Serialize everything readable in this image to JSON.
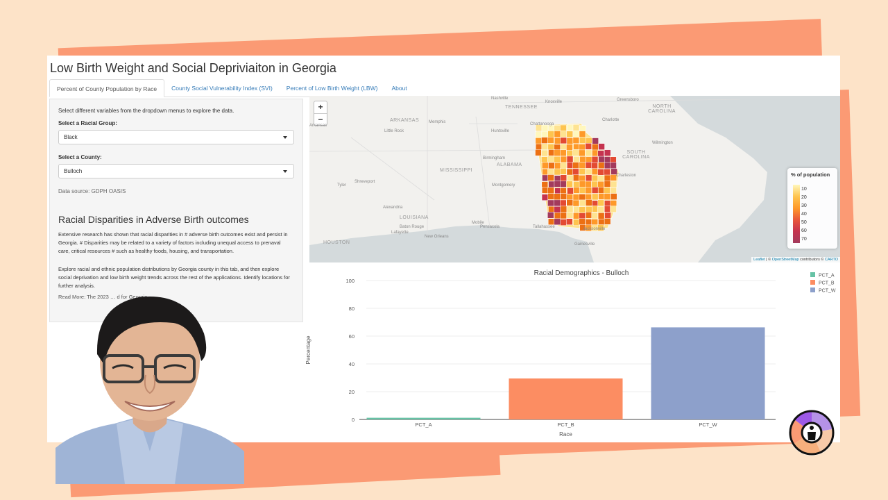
{
  "app": {
    "title": "Low Birth Weight and Social Depriviaiton in Georgia",
    "tabs": [
      {
        "label": "Percent of County Population by Race",
        "active": true
      },
      {
        "label": "County Social Vulnerability Index (SVI)",
        "active": false
      },
      {
        "label": "Percent of Low Birth Weight (LBW)",
        "active": false
      },
      {
        "label": "About",
        "active": false
      }
    ]
  },
  "sidebar": {
    "help_text": "Select different variables from the dropdown menus to explore the data.",
    "race_label": "Select a Racial Group:",
    "race_value": "Black",
    "county_label": "Select a County:",
    "county_value": "Bulloch",
    "data_source": "Data source: GDPH OASIS",
    "heading": "Racial Disparities in Adverse Birth outcomes",
    "paragraph1": "Extensive research has shown that racial disparities in # adverse birth outcomes exist and persist in Georgia. # Disparities may be related to a variety of factors including unequal access to prenaval care, critical resources # such as healthy foods, housing, and transportation.",
    "paragraph2": "Explore racial and ethnic population distributions by Georgia county in this tab, and then explore social deprivation and low birth weight trends across the rest of the applications. Identify locations for further analysis.",
    "read_more": "Read More: The 2023 … d for Georgia"
  },
  "map": {
    "zoom_in": "+",
    "zoom_out": "−",
    "labels": {
      "nashville": "Nashville",
      "knoxville": "Knoxville",
      "greensboro": "Greensboro",
      "tennessee": "TENNESSEE",
      "north_carolina": "NORTH CAROLINA",
      "arkansas": "ARKANSAS",
      "memphis": "Memphis",
      "chattanooga": "Chattanooga",
      "charlotte": "Charlotte",
      "little_rock": "Little Rock",
      "huntsville": "Huntsville",
      "wilmington": "Wilmington",
      "mississippi": "MISSISSIPPI",
      "birmingham": "Birmingham",
      "alabama": "ALABAMA",
      "south_carolina": "SOUTH CAROLINA",
      "tyler": "Tyler",
      "shreveport": "Shreveport",
      "montgomery": "Montgomery",
      "charleston": "Charleston",
      "alexandria": "Alexandria",
      "louisiana": "LOUISIANA",
      "baton_rouge": "Baton Rouge",
      "lafayette": "Lafayette",
      "new_orleans": "New Orleans",
      "mobile": "Mobile",
      "pensacola": "Pensacola",
      "tallahassee": "Tallahassee",
      "jacksonville": "Jacksonville",
      "houston": "HOUSTON",
      "gainesville": "Gainesville",
      "arkansas_small": "Arkansas"
    },
    "legend": {
      "title": "% of population",
      "ticks": [
        "10",
        "20",
        "30",
        "40",
        "50",
        "60",
        "70"
      ]
    },
    "attribution": {
      "leaflet": "Leaflet",
      "sep": " | © ",
      "osm": "OpenStreetMap",
      "contrib": " contributors © ",
      "carto": "CARTO"
    },
    "colors": [
      "#fff7bc",
      "#fee391",
      "#fec44f",
      "#fe9929",
      "#ec7014",
      "#e34a33",
      "#c5334f",
      "#a33a5c"
    ]
  },
  "chart_data": {
    "type": "bar",
    "title": "Racial Demographics - Bulloch",
    "categories": [
      "PCT_A",
      "PCT_B",
      "PCT_W"
    ],
    "values": [
      1.2,
      29.5,
      66.3
    ],
    "colors": [
      "#66c2a5",
      "#fc8d62",
      "#8da0cb"
    ],
    "xlabel": "Race",
    "ylabel": "Percentage",
    "ylim": [
      0,
      100
    ],
    "yticks": [
      0,
      20,
      40,
      60,
      80,
      100
    ],
    "legend": [
      "PCT_A",
      "PCT_B",
      "PCT_W"
    ],
    "legend_position": "top-right",
    "grid": true
  }
}
